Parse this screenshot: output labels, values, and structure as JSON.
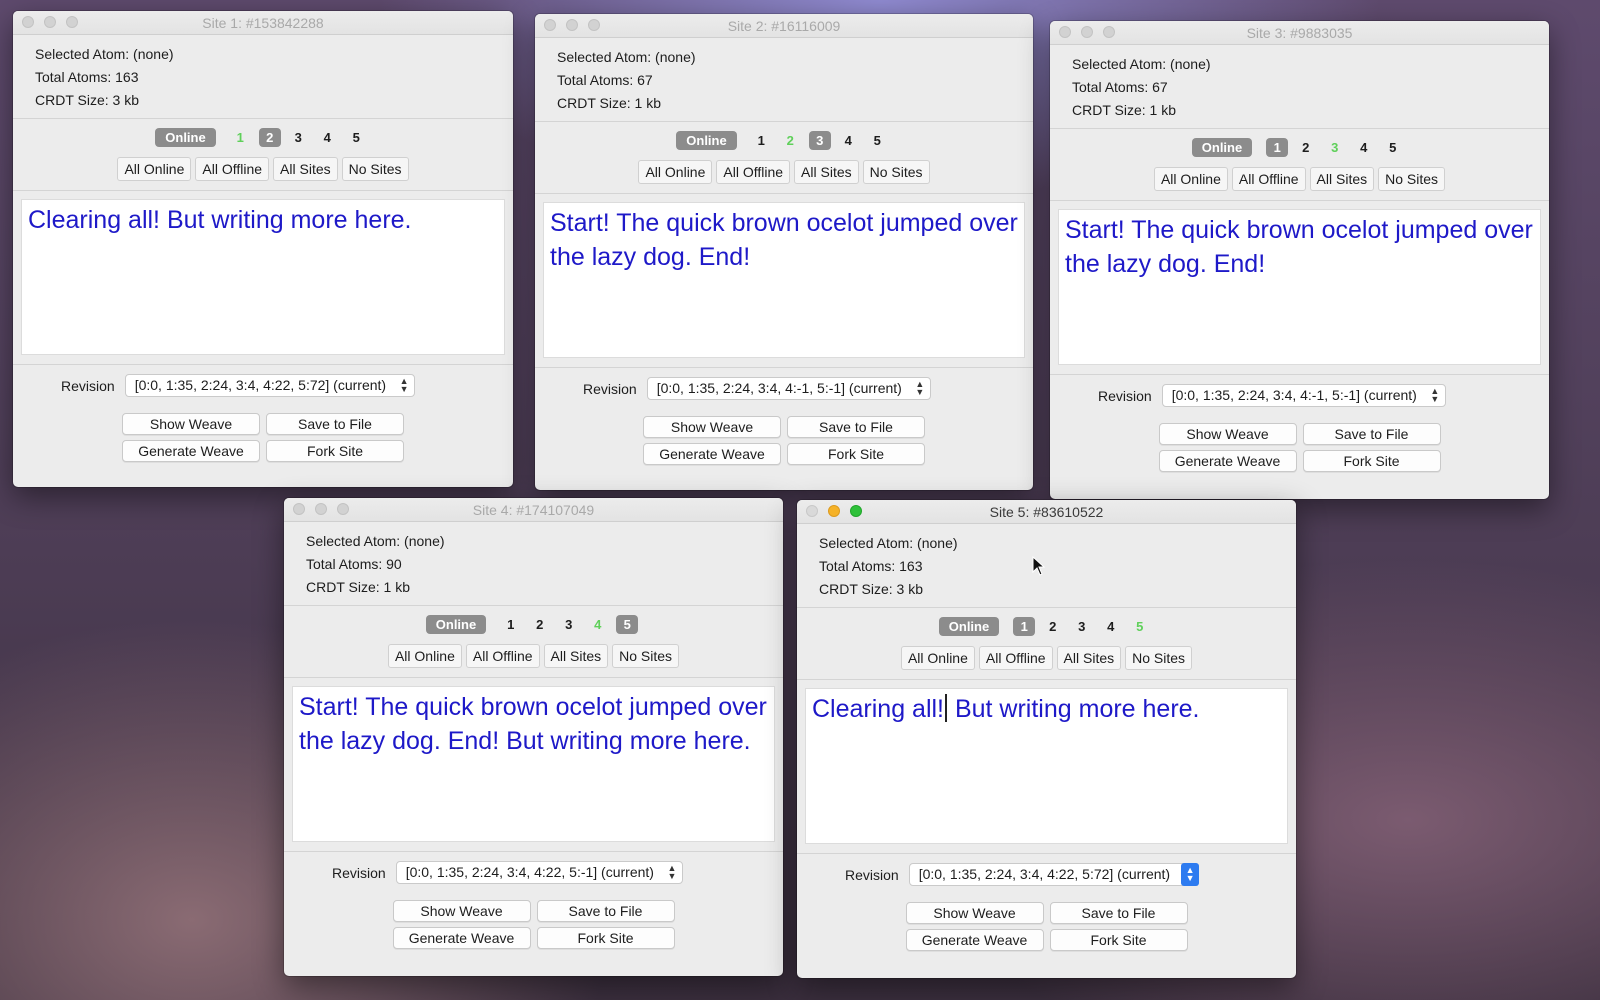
{
  "windows": [
    {
      "title": "Site 1: #153842288",
      "selected_atom": "Selected Atom: (none)",
      "total_atoms": "Total Atoms: 163",
      "crdt_size": "CRDT Size: 3 kb",
      "online_label": "Online",
      "sites": [
        "1",
        "2",
        "3",
        "4",
        "5"
      ],
      "self_site": 1,
      "boxed_site": 2,
      "filters": [
        "All Online",
        "All Offline",
        "All Sites",
        "No Sites"
      ],
      "editor_text": "Clearing all! But writing more here.",
      "revision_label": "Revision",
      "revision_value": "[0:0, 1:35, 2:24, 3:4, 4:22, 5:72] (current)",
      "buttons": [
        "Show Weave",
        "Save to File",
        "Generate Weave",
        "Fork Site"
      ]
    },
    {
      "title": "Site 2: #16116009",
      "selected_atom": "Selected Atom: (none)",
      "total_atoms": "Total Atoms: 67",
      "crdt_size": "CRDT Size: 1 kb",
      "online_label": "Online",
      "sites": [
        "1",
        "2",
        "3",
        "4",
        "5"
      ],
      "self_site": 2,
      "boxed_site": 3,
      "filters": [
        "All Online",
        "All Offline",
        "All Sites",
        "No Sites"
      ],
      "editor_text": "Start! The quick brown ocelot jumped over the lazy dog. End!",
      "revision_label": "Revision",
      "revision_value": "[0:0, 1:35, 2:24, 3:4, 4:-1, 5:-1] (current)",
      "buttons": [
        "Show Weave",
        "Save to File",
        "Generate Weave",
        "Fork Site"
      ]
    },
    {
      "title": "Site 3: #9883035",
      "selected_atom": "Selected Atom: (none)",
      "total_atoms": "Total Atoms: 67",
      "crdt_size": "CRDT Size: 1 kb",
      "online_label": "Online",
      "sites": [
        "1",
        "2",
        "3",
        "4",
        "5"
      ],
      "self_site": 3,
      "boxed_site": 1,
      "filters": [
        "All Online",
        "All Offline",
        "All Sites",
        "No Sites"
      ],
      "editor_text": "Start! The quick brown ocelot jumped over the lazy dog. End!",
      "revision_label": "Revision",
      "revision_value": "[0:0, 1:35, 2:24, 3:4, 4:-1, 5:-1] (current)",
      "buttons": [
        "Show Weave",
        "Save to File",
        "Generate Weave",
        "Fork Site"
      ]
    },
    {
      "title": "Site 4: #174107049",
      "selected_atom": "Selected Atom: (none)",
      "total_atoms": "Total Atoms: 90",
      "crdt_size": "CRDT Size: 1 kb",
      "online_label": "Online",
      "sites": [
        "1",
        "2",
        "3",
        "4",
        "5"
      ],
      "self_site": 4,
      "boxed_site": 5,
      "filters": [
        "All Online",
        "All Offline",
        "All Sites",
        "No Sites"
      ],
      "editor_text": "Start! The quick brown ocelot jumped over the lazy dog. End! But writing more here.",
      "revision_label": "Revision",
      "revision_value": "[0:0, 1:35, 2:24, 3:4, 4:22, 5:-1] (current)",
      "buttons": [
        "Show Weave",
        "Save to File",
        "Generate Weave",
        "Fork Site"
      ]
    },
    {
      "title": "Site 5: #83610522",
      "selected_atom": "Selected Atom: (none)",
      "total_atoms": "Total Atoms: 163",
      "crdt_size": "CRDT Size: 3 kb",
      "online_label": "Online",
      "sites": [
        "1",
        "2",
        "3",
        "4",
        "5"
      ],
      "self_site": 5,
      "boxed_site": 1,
      "filters": [
        "All Online",
        "All Offline",
        "All Sites",
        "No Sites"
      ],
      "editor_text_before_caret": "Clearing all!",
      "editor_text_after_caret": " But writing more here.",
      "revision_label": "Revision",
      "revision_value": "[0:0, 1:35, 2:24, 3:4, 4:22, 5:72] (current)",
      "buttons": [
        "Show Weave",
        "Save to File",
        "Generate Weave",
        "Fork Site"
      ]
    }
  ],
  "colors": {
    "editor_text": "#1e19c8",
    "self_site": "#5fd05a",
    "badge": "#8c8c8c",
    "active_select_stepper": "#2d7bf0"
  }
}
